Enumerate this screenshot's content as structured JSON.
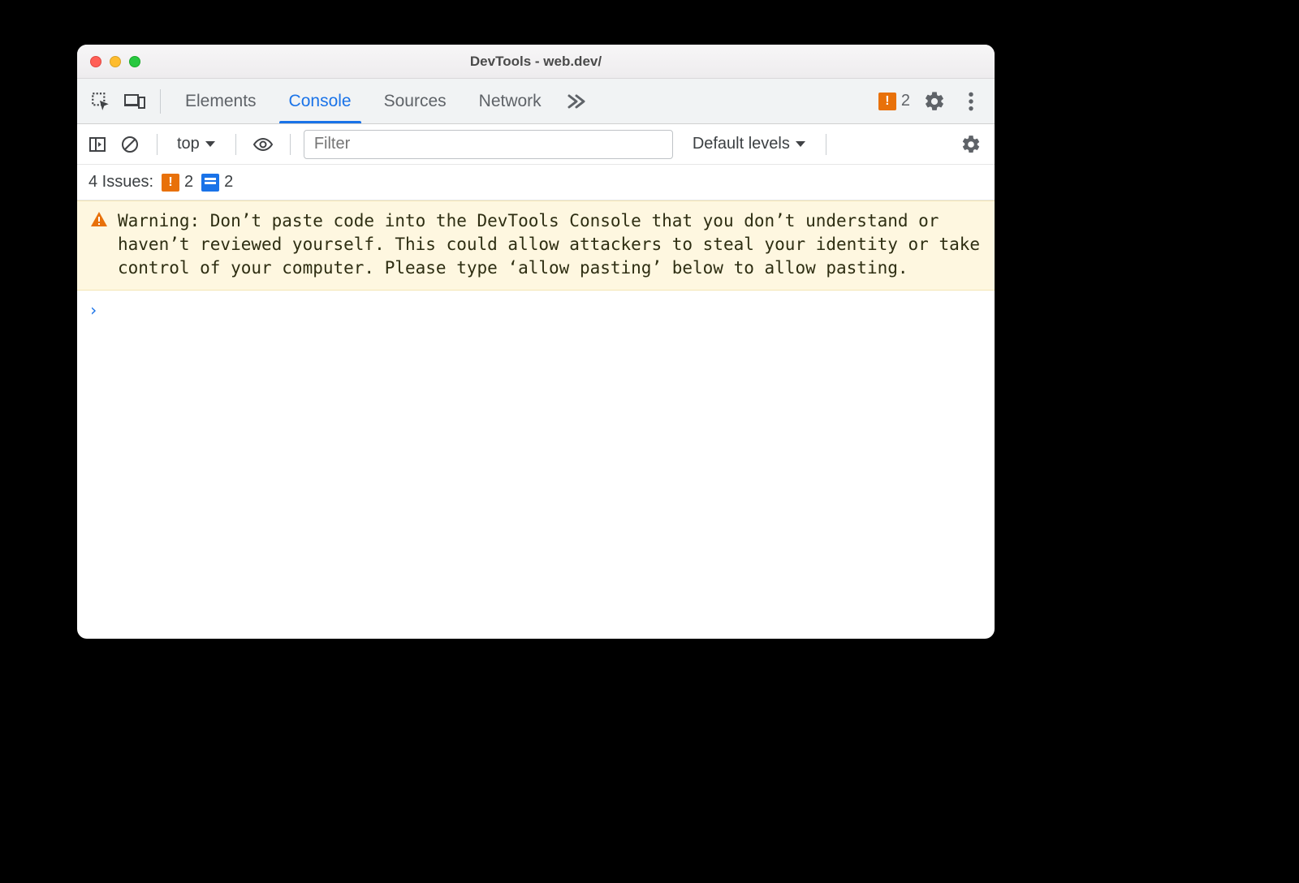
{
  "window": {
    "title": "DevTools - web.dev/"
  },
  "tabs": {
    "elements": "Elements",
    "console": "Console",
    "sources": "Sources",
    "network": "Network"
  },
  "header": {
    "error_count": "2"
  },
  "toolbar": {
    "context": "top",
    "filter_placeholder": "Filter",
    "levels": "Default levels"
  },
  "issues": {
    "label": "4 Issues:",
    "orange_count": "2",
    "blue_count": "2"
  },
  "warning": {
    "text": "Warning: Don’t paste code into the DevTools Console that you don’t understand or haven’t reviewed yourself. This could allow attackers to steal your identity or take control of your computer. Please type ‘allow pasting’ below to allow pasting."
  },
  "prompt": {
    "symbol": "›"
  }
}
